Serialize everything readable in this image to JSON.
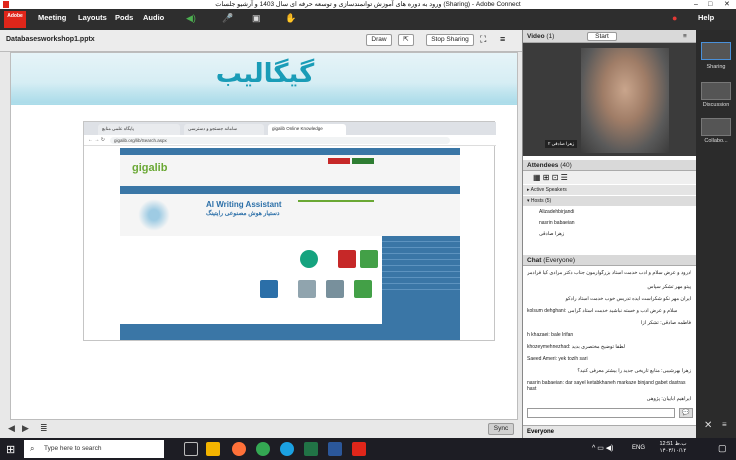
{
  "window": {
    "title": "ورود به دوره های آموزش توانمندسازی و توسعه حرفه ای سال 1403 و آرشیو جلسات (Sharing) - Adobe Connect",
    "logo": "Adobe"
  },
  "menu": {
    "items": [
      "Meeting",
      "Layouts",
      "Pods",
      "Audio"
    ],
    "help": "Help"
  },
  "share": {
    "filename": "Databasesworkshop1.pptx",
    "draw": "Draw",
    "stop": "Stop Sharing",
    "sync": "Sync"
  },
  "slide": {
    "banner_title": "گیگالیب",
    "tabs": [
      "gigalib Online Knowledge",
      "سامانه جستجو و دسترسی",
      "پایگاه علمی منابع"
    ],
    "url": "gigalib.org/lib/Search.aspx",
    "logo": "gigalib",
    "ai_title": "AI Writing Assistant",
    "ai_sub": "دستیار هوش مصنوعی رایتینگ"
  },
  "video": {
    "title": "Video",
    "count": "(1)",
    "start": "Start",
    "name_tag": "زهرا صادقی ۲"
  },
  "attendees": {
    "title": "Attendees",
    "count": "(40)",
    "active_speakers": "Active Speakers",
    "hosts": "Hosts (5)",
    "people": [
      "Alizadehbirjandi",
      "nasrin babaeian",
      "زهرا صادقی"
    ]
  },
  "chat": {
    "title": "Chat",
    "scope": "(Everyone)",
    "tab": "Everyone",
    "messages": [
      "بادرود و عرض سلام و ادب خدمت استاد بزرگوارمون جناب دکتر مرادی کیا فرادمر",
      "پیتو مهر تشکر سپاس",
      "ایران مهر نکو شکراست ایده تدریس خوب خدمت استاد رادکو",
      "kolsum dehghani: سلام و عرض ادب و خسته نباشید خدمت استاد گرامی",
      "فاطمه صادقی: تشکر ازا",
      "h khazaei: bale Irifan",
      "khozeymehnezhad: لطفا توضیح مختصری بدید",
      "Saeed Ameri: yek tozih sari",
      "زهرا بهرشیبی: منابع تاریخی جدید را بیشتر معرفی کنید؟",
      "nasrin babaeian: dar sayel ketabkhaneh markaze binjand gabet dastras hast",
      "ایراهیم آباییان: پژوهی"
    ]
  },
  "sidebar": {
    "items": [
      "Sharing",
      "Discussion",
      "Collabo..."
    ]
  },
  "taskbar": {
    "search_placeholder": "Type here to search",
    "lang": "ENG",
    "time": "12:51 ب.ظ",
    "date": "۱۴۰۳/۱۰/۱۲"
  }
}
